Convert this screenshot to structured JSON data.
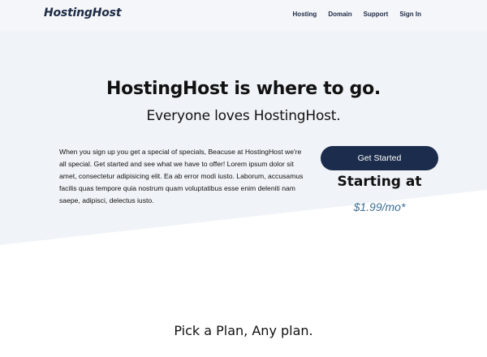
{
  "header": {
    "brand": "HostingHost",
    "nav": [
      {
        "label": "Hosting"
      },
      {
        "label": "Domain"
      },
      {
        "label": "Support"
      },
      {
        "label": "Sign In"
      }
    ]
  },
  "hero": {
    "title": "HostingHost is where to go.",
    "subtitle": "Everyone loves HostingHost.",
    "intro": "When you sign up you get a special of specials, Beacuse at HostingHost we're all special. Get started and see what we have to offer! Lorem ipsum dolor sit amet, consectetur adipisicing elit. Ea ab error modi iusto. Laborum, accusamus facilis quas tempore quia nostrum quam voluptatibus esse enim deleniti nam saepe, adipisci, delectus iusto.",
    "cta_label": "Get Started",
    "price_heading": "Starting at",
    "price": "$1.99/mo*"
  },
  "plans": {
    "heading": "Pick a Plan, Any plan."
  },
  "colors": {
    "hero_background": "#f0f3f7",
    "brand_navy": "#1c2c4c",
    "price_accent": "#3b6f93"
  }
}
